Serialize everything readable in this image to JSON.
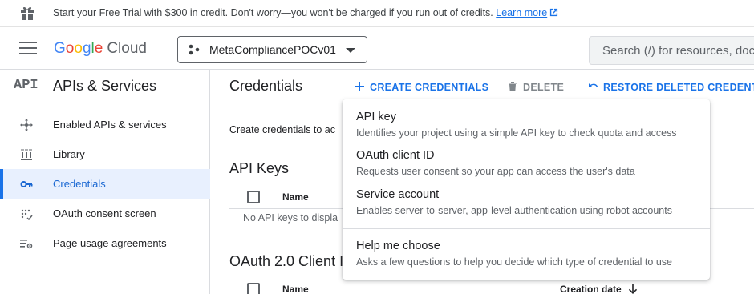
{
  "banner": {
    "text": "Start your Free Trial with $300 in credit. Don't worry—you won't be charged if you run out of credits.",
    "link": "Learn more"
  },
  "header": {
    "logo": {
      "g1": "G",
      "o1": "o",
      "o2": "o",
      "g2": "g",
      "l": "l",
      "e": "e",
      "cloud": "Cloud"
    },
    "project_name": "MetaCompliancePOCv01",
    "search_placeholder": "Search (/) for resources, docs"
  },
  "sidebar": {
    "api_badge": "API",
    "title": "APIs & Services",
    "items": [
      {
        "label": "Enabled APIs & services",
        "icon": "hub-icon",
        "active": false
      },
      {
        "label": "Library",
        "icon": "library-icon",
        "active": false
      },
      {
        "label": "Credentials",
        "icon": "key-icon",
        "active": true
      },
      {
        "label": "OAuth consent screen",
        "icon": "consent-icon",
        "active": false
      },
      {
        "label": "Page usage agreements",
        "icon": "settings-list-icon",
        "active": false
      }
    ]
  },
  "main": {
    "title": "Credentials",
    "create_label": "CREATE CREDENTIALS",
    "delete_label": "DELETE",
    "restore_label": "RESTORE DELETED CREDENTIALS",
    "description": "Create credentials to ac",
    "api_keys_title": "API Keys",
    "api_keys_col_name": "Name",
    "api_keys_empty": "No API keys to displa",
    "oauth_title": "OAuth 2.0 Client I",
    "oauth_col_name": "Name",
    "oauth_col_created": "Creation date"
  },
  "menu": {
    "items": [
      {
        "title": "API key",
        "desc": "Identifies your project using a simple API key to check quota and access"
      },
      {
        "title": "OAuth client ID",
        "desc": "Requests user consent so your app can access the user's data"
      },
      {
        "title": "Service account",
        "desc": "Enables server-to-server, app-level authentication using robot accounts"
      },
      {
        "title": "Help me choose",
        "desc": "Asks a few questions to help you decide which type of credential to use"
      }
    ]
  },
  "colors": {
    "accent": "#1a73e8",
    "active_bg": "#e8f0fe",
    "text": "#202124",
    "muted": "#5f6368"
  }
}
